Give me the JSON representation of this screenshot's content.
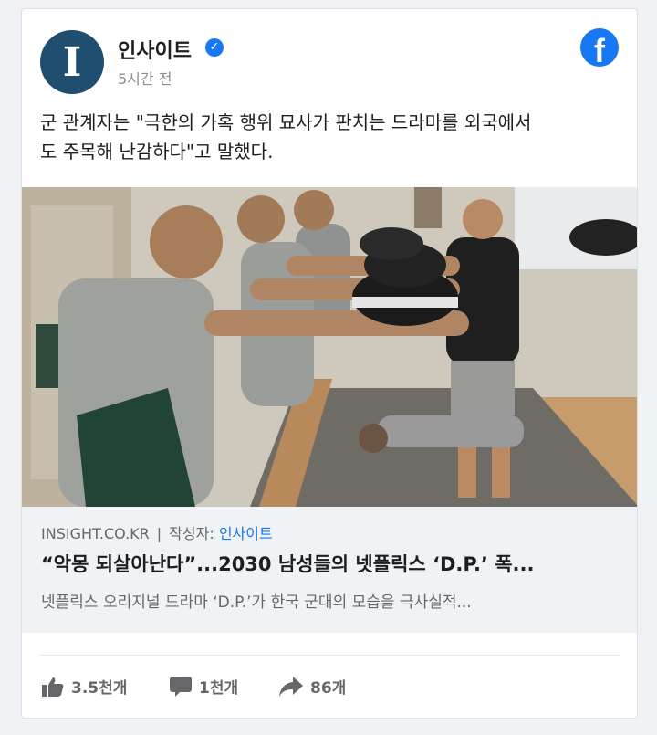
{
  "page": {
    "name": "인사이트",
    "avatar_letter": "I",
    "time": "5시간 전"
  },
  "post": {
    "text_line1": "군 관계자는 \"극한의 가혹 행위 묘사가 판치는 드라마를 외국에서",
    "text_line2": "도 주목해 난감하다\"고 말했다."
  },
  "link": {
    "domain": "INSIGHT.CO.KR",
    "separator": "|",
    "author_label": "작성자:",
    "author_name": "인사이트",
    "title": "“악몽 되살아난다”...2030 남성들의 넷플릭스 ‘D.P.’ 폭...",
    "description": "넷플릭스 오리지널 드라마 ‘D.P.’가 한국 군대의 모습을 극사실적..."
  },
  "actions": {
    "likes": "3.5천개",
    "comments": "1천개",
    "shares": "86개"
  },
  "icons": {
    "verified": "verified-badge-icon",
    "facebook": "facebook-logo-icon",
    "like": "thumbs-up-icon",
    "comment": "comment-bubble-icon",
    "share": "share-arrow-icon"
  },
  "colors": {
    "accent": "#1877f2",
    "avatar": "#1f4e6e",
    "muted_text": "#65676b",
    "link_bg": "#f0f2f5"
  }
}
